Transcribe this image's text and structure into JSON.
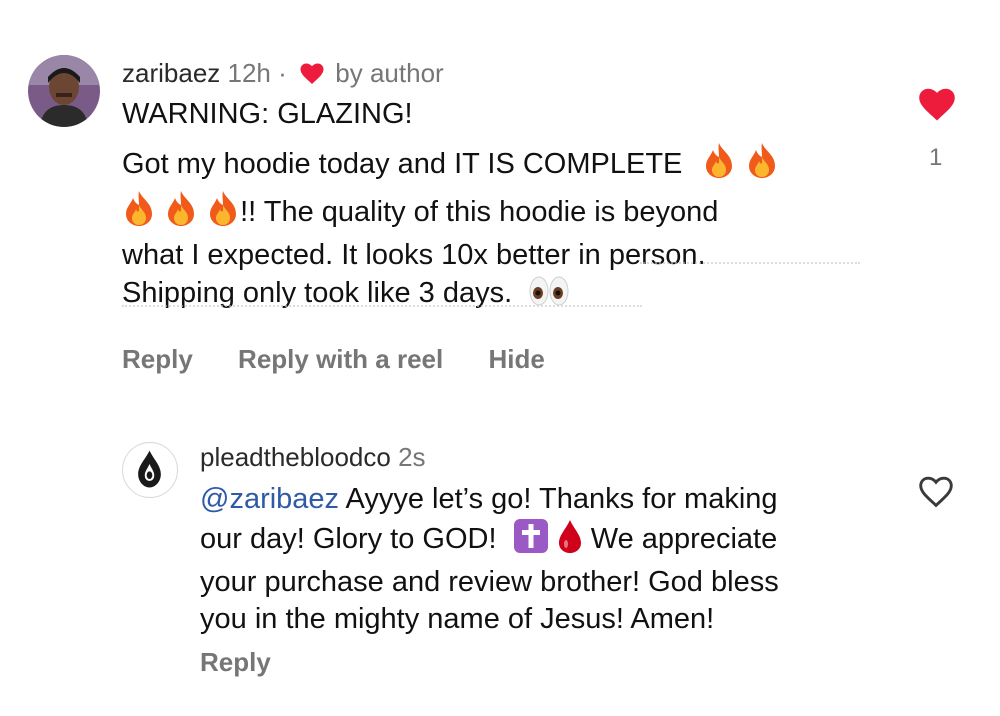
{
  "comments": [
    {
      "username": "zaribaez",
      "time": "12h",
      "separator": "·",
      "liked_by": "by author",
      "title_line": "WARNING: GLAZING!",
      "text_1": "Got my hoodie today and IT IS COMPLETE",
      "text_2": "!! The quality of this hoodie is beyond",
      "text_3": "what I expected. It looks 10x better in person.",
      "text_4": "Shipping only took like 3 days.",
      "like_count": "1",
      "actions": {
        "reply": "Reply",
        "reply_reel": "Reply with a reel",
        "hide": "Hide"
      }
    },
    {
      "username": "pleadthebloodco",
      "time": "2s",
      "mention": "@zaribaez",
      "text_1": "Ayyye let’s go! Thanks for making",
      "text_2": "our day! Glory to GOD!",
      "text_3": "We appreciate",
      "text_4": "your purchase and review brother! God bless",
      "text_5": "you in the mighty name of Jesus! Amen!",
      "actions": {
        "reply": "Reply"
      }
    }
  ],
  "icons": {
    "heart_filled": "heart-filled-icon",
    "heart_outline": "heart-outline-icon",
    "fire": "fire-emoji",
    "eyes": "eyes-emoji",
    "cross": "latin-cross-emoji",
    "drop": "blood-drop-emoji"
  },
  "colors": {
    "like_red": "#ed1c3c",
    "mention_blue": "#2f5aa8",
    "muted": "#767676"
  }
}
